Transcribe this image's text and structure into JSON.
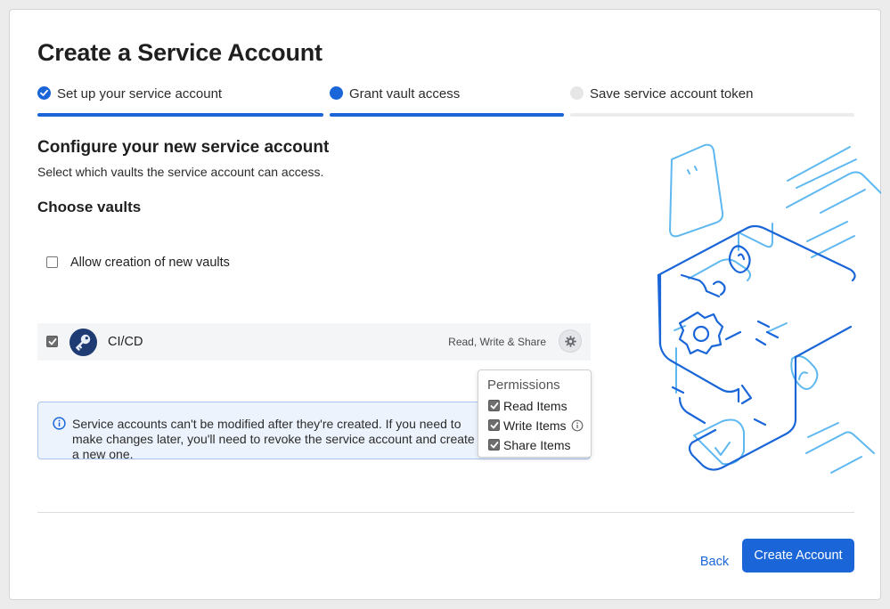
{
  "page": {
    "title": "Create a Service Account"
  },
  "stepper": {
    "steps": [
      {
        "label": "Set up your service account",
        "state": "done"
      },
      {
        "label": "Grant vault access",
        "state": "active"
      },
      {
        "label": "Save service account token",
        "state": "pending"
      }
    ]
  },
  "configure": {
    "title": "Configure your new service account",
    "subtitle": "Select which vaults the service account can access."
  },
  "vaults": {
    "title": "Choose vaults",
    "allow_new_label": "Allow creation of new vaults",
    "allow_new_checked": false,
    "items": [
      {
        "name": "CI/CD",
        "permissions": "Read, Write & Share",
        "checked": true,
        "icon": "key-icon"
      }
    ]
  },
  "permissions_popover": {
    "title": "Permissions",
    "items": [
      {
        "label": "Read Items",
        "checked": true
      },
      {
        "label": "Write Items",
        "checked": true,
        "has_info": true
      },
      {
        "label": "Share Items",
        "checked": true
      }
    ]
  },
  "info": {
    "text": "Service accounts can't be modified after they're created. If you need to make changes later, you'll need to revoke the service account and create a new one."
  },
  "footer": {
    "back_label": "Back",
    "create_label": "Create Account"
  },
  "colors": {
    "accent": "#1a66d9",
    "info_bg": "#edf3fc",
    "info_border": "#a9c4ee",
    "illustration_dark": "#1a66d9",
    "illustration_light": "#5fb8f0"
  }
}
